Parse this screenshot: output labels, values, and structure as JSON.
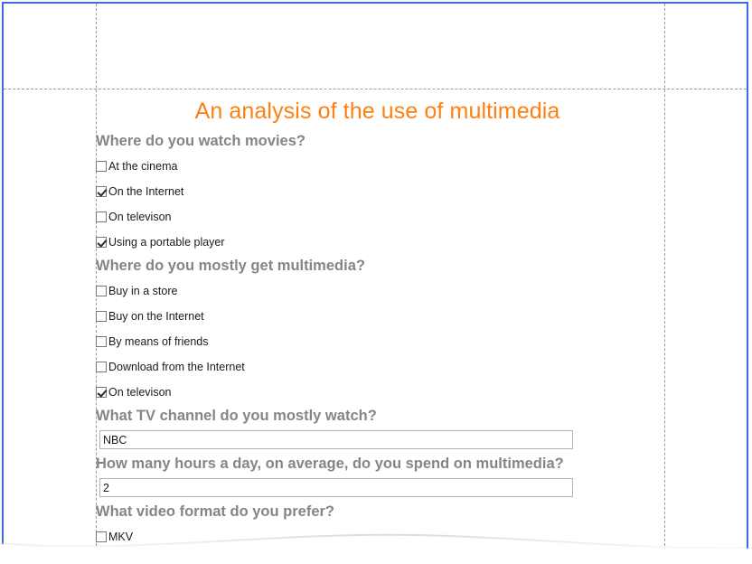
{
  "document": {
    "title": "An analysis of the use of multimedia",
    "title_color": "#ff7f11",
    "heading_color": "#858585",
    "page_border_color": "#4169e1",
    "margin_guide_color": "#9a9a9a"
  },
  "questions": [
    {
      "id": "where-watch-movies",
      "heading": "Where do you watch movies?",
      "type": "checkbox-group",
      "options": [
        {
          "label": "At the cinema",
          "checked": false
        },
        {
          "label": "On the Internet",
          "checked": true
        },
        {
          "label": "On televison",
          "checked": false
        },
        {
          "label": "Using a portable player",
          "checked": true
        }
      ]
    },
    {
      "id": "where-get-multimedia",
      "heading": "Where do you mostly get multimedia?",
      "type": "checkbox-group",
      "options": [
        {
          "label": "Buy in a store",
          "checked": false
        },
        {
          "label": "Buy on the Internet",
          "checked": false
        },
        {
          "label": "By means of friends",
          "checked": false
        },
        {
          "label": "Download from the Internet",
          "checked": false
        },
        {
          "label": "On televison",
          "checked": true
        }
      ]
    },
    {
      "id": "tv-channel",
      "heading": "What TV channel do you mostly watch?",
      "type": "text",
      "value": "NBC",
      "placeholder": ""
    },
    {
      "id": "hours-per-day",
      "heading": "How many hours a day, on average, do you spend on multimedia?",
      "type": "text",
      "value": "2",
      "placeholder": ""
    },
    {
      "id": "video-format",
      "heading": "What video format do you prefer?",
      "type": "checkbox-group",
      "options": [
        {
          "label": "MKV",
          "checked": false
        }
      ]
    }
  ]
}
